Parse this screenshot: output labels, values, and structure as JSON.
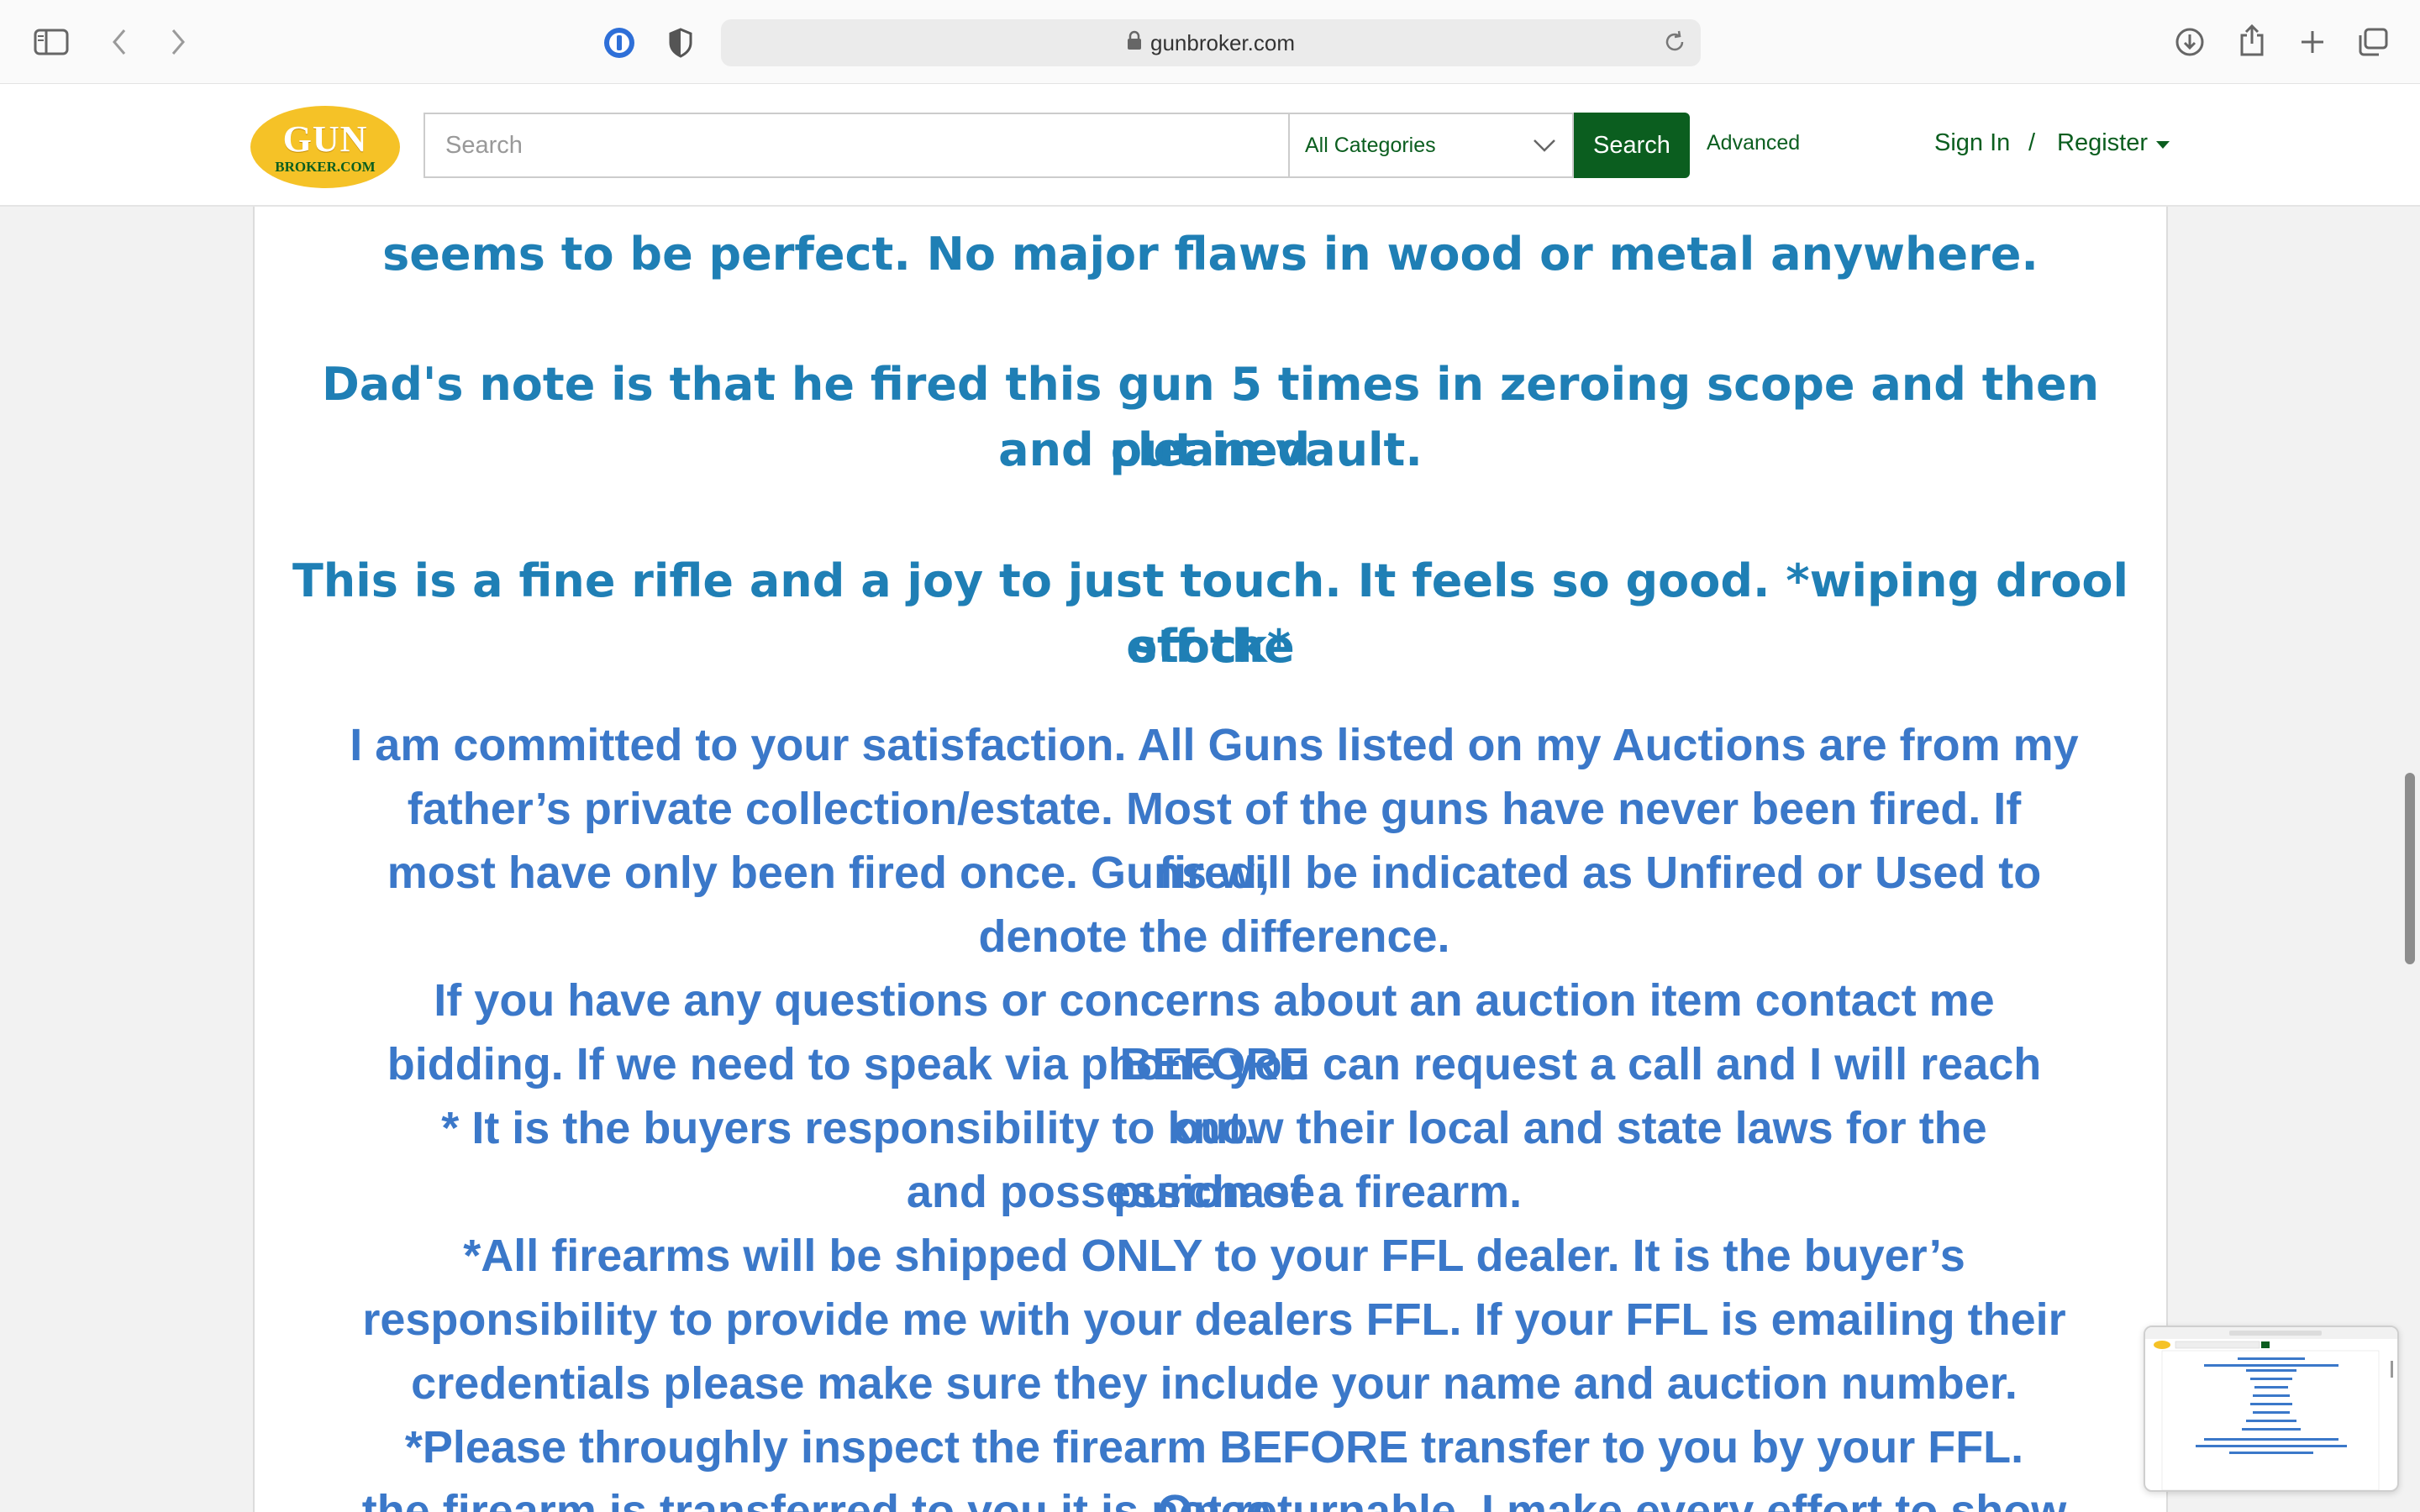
{
  "browser": {
    "url": "gunbroker.com",
    "icons": [
      "sidebar-icon",
      "back-icon",
      "forward-icon",
      "password-manager-icon",
      "privacy-shield-icon",
      "lock-icon",
      "reload-icon",
      "download-icon",
      "share-icon",
      "new-tab-icon",
      "tab-overview-icon"
    ]
  },
  "header": {
    "logo_top": "GUN",
    "logo_bottom": "BROKER.COM",
    "search_placeholder": "Search",
    "category_selected": "All Categories",
    "search_button": "Search",
    "advanced_link": "Advanced",
    "sign_in": "Sign In",
    "separator": "/",
    "register": "Register",
    "brand_color": "#0b5e1f"
  },
  "content": {
    "lines_a": [
      "seems to be perfect. No major flaws in wood or metal anywhere.",
      "Dad's note is that he fired this gun 5 times in zeroing scope and then cleaned",
      "and put in vault.",
      "This is a fine rifle and a joy to just touch.  It feels so good.  *wiping drool off the",
      "stock*"
    ],
    "lines_b": [
      "I am committed to your satisfaction.  All Guns listed on my Auctions are from my",
      "father’s private collection/estate.  Most of the guns have never been fired.  If fired,",
      "most have only been fired once.  Guns will be indicated as Unfired or Used to",
      "denote the difference.",
      "If you have any questions or concerns about an auction item contact me BEFORE",
      "bidding. If we need to speak via phone you can request a call and I will reach out.",
      "* It is the buyers responsibility to know their local and state laws for the purchase",
      "and possession of a firearm.",
      "*All firearms will be shipped ONLY to your FFL dealer.  It is the buyer’s",
      "responsibility to provide me with your dealers FFL.  If your FFL is emailing their",
      "credentials please make sure they include your name and auction number.",
      "*Please throughly inspect the firearm BEFORE transfer to you by your FFL. Once",
      "the firearm is transferred to you it is not returnable.  I make every effort to show"
    ],
    "color_a": "#1f7fb5",
    "color_b": "#3b78c9"
  }
}
